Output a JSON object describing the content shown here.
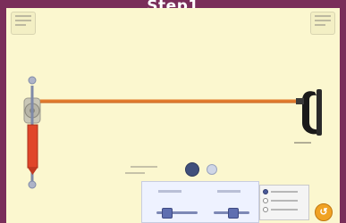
{
  "header": {
    "title": "Step1"
  },
  "top_left": {
    "box_icon": "string-settings-icon",
    "small_label": ""
  },
  "top_right": {
    "box_icon": "view-options-icon"
  },
  "scene": {
    "wave_color": "#e27c2e",
    "oscillator_color": "#e0462a",
    "clamp_label": ""
  },
  "controls": {
    "time_label": "",
    "play_icon": "play-icon",
    "step_icon": "step-icon",
    "reset_icon": "reset-icon",
    "reset_glyph": "↺"
  },
  "sliders": {
    "damping_label": "",
    "tension_label": "",
    "damping_value": 0.3,
    "tension_value": 0.5
  },
  "end_options": {
    "options": [
      "",
      "",
      ""
    ],
    "selected": 0
  },
  "colors": {
    "frame": "#7a2e5a",
    "stage": "#fbf7cf",
    "reset": "#f0a224"
  }
}
